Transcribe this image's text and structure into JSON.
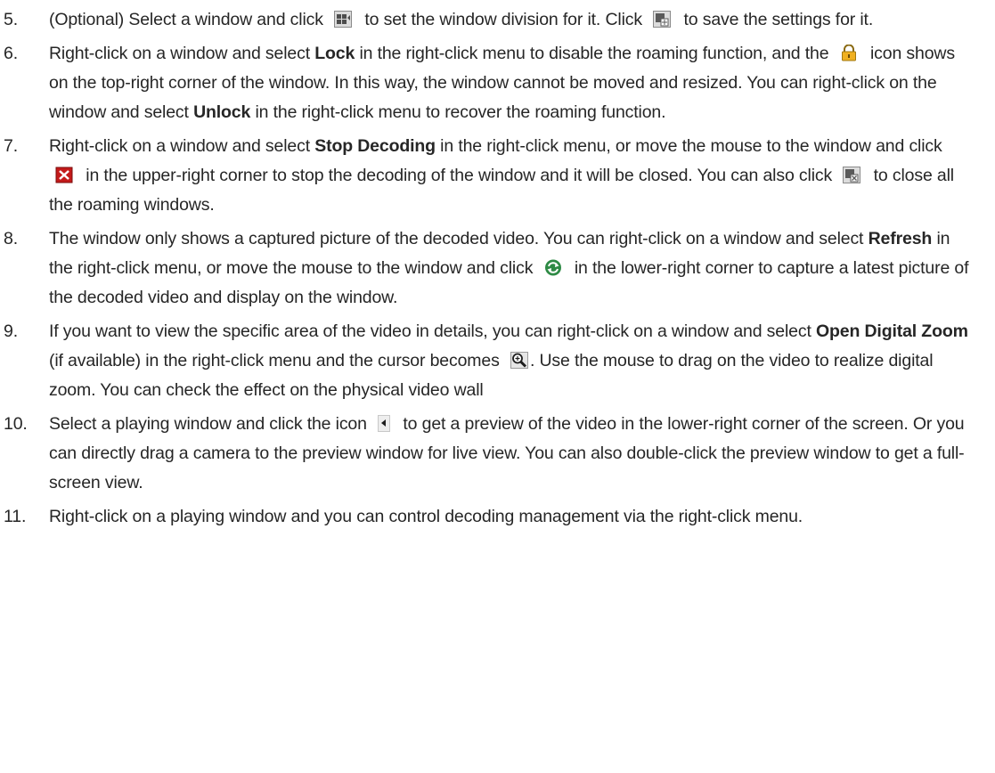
{
  "steps": [
    {
      "number": "5.",
      "s1": "(Optional) Select a window and click",
      "icon1": "window-division-icon",
      "s2": "to set the window division for it. Click",
      "icon2": "save-settings-icon",
      "s3": "to save the settings for it."
    },
    {
      "number": "6.",
      "s1": "Right-click on a window and select",
      "b1": "Lock",
      "s2": "in the right-click menu to disable the roaming function, and the",
      "icon1": "lock-icon",
      "s3": "icon shows on the top-right corner of the window. In this way, the window cannot be moved and resized. You can right-click on the window and select",
      "b2": "Unlock",
      "s4": "in the right-click menu to recover the roaming function."
    },
    {
      "number": "7.",
      "s1": "Right-click on a window and select",
      "b1": "Stop Decoding",
      "s2": "in the right-click menu, or move the mouse to the window and click",
      "icon1": "stop-decoding-icon",
      "s3": "in the upper-right corner to stop the decoding of the window and it will be closed. You can also click",
      "icon2": "close-all-windows-icon",
      "s4": "to close all the roaming windows."
    },
    {
      "number": "8.",
      "s1": "The window only shows a captured picture of the decoded video. You can right-click on a window and select",
      "b1": "Refresh",
      "s2": "in the right-click menu, or move the mouse to the window and click",
      "icon1": "refresh-icon",
      "s3": "in the lower-right corner to capture a latest picture of the decoded video and display on the window."
    },
    {
      "number": "9.",
      "s1": "If you want to view the specific area of the video in details, you can right-click on a window and select",
      "b1": "Open Digital Zoom",
      "s2": "(if available) in the right-click menu and the cursor becomes",
      "icon1": "digital-zoom-cursor-icon",
      "s3": ". Use the mouse to drag on the video to realize digital zoom. You can check the effect on the physical video wall"
    },
    {
      "number": "10.",
      "s1": "Select a playing window and click the icon",
      "icon1": "preview-arrow-icon",
      "s2": "to get a preview of the video in the lower-right corner of the screen. Or you can directly drag a camera to the preview window for live view. You can also double-click the preview window to get a full-screen view."
    },
    {
      "number": "11.",
      "s1": "Right-click on a playing window and you can control decoding management via the right-click menu."
    }
  ]
}
